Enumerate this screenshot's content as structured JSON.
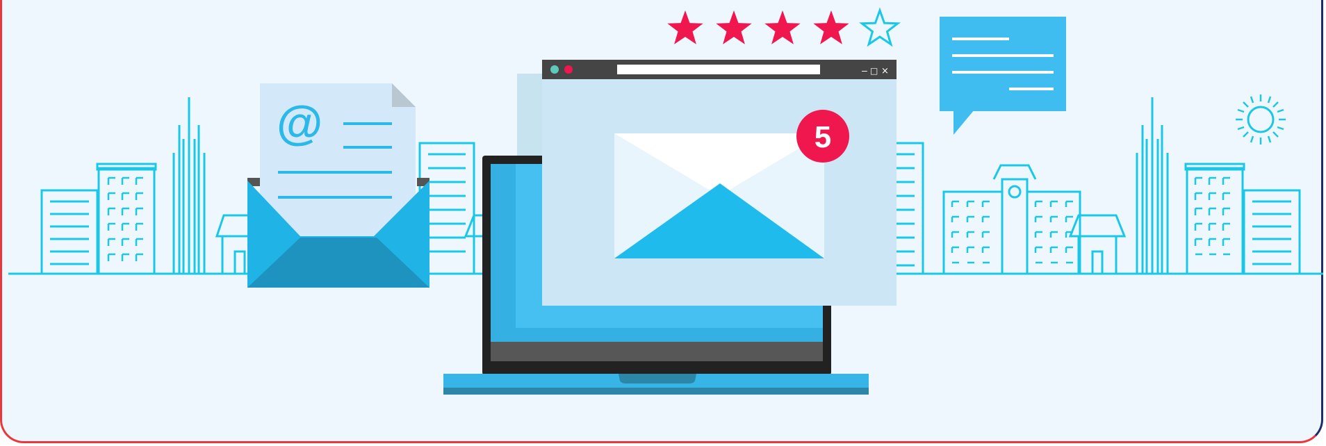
{
  "notification": {
    "count": "5"
  },
  "rating": {
    "filled": 4,
    "total": 5
  },
  "window_controls": {
    "minimize": "–",
    "maximize": "□",
    "close": "×"
  },
  "colors": {
    "accent_red": "#f0174f",
    "accent_blue": "#2ab9e8",
    "outline_cyan": "#19c8e6",
    "dark_frame": "#222222",
    "frame_border_left": "#e8383d",
    "frame_border_right": "#1d2a6b",
    "background": "#eef7fd"
  },
  "icons": {
    "email_at": "@",
    "chat": "chat-bubble-icon",
    "sun": "sun-icon",
    "star": "star-icon"
  }
}
